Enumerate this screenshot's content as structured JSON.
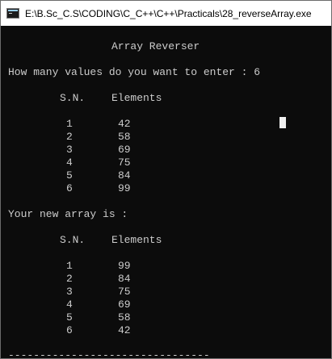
{
  "window": {
    "title": "E:\\B.Sc_C.S\\CODING\\C_C++\\C++\\Practicals\\28_reverseArray.exe"
  },
  "console": {
    "heading": "Array Reverser",
    "prompt": "How many values do you want to enter : 6",
    "col_sn": "S.N.",
    "col_elements": "Elements",
    "input_rows": [
      {
        "sn": "1",
        "value": "42"
      },
      {
        "sn": "2",
        "value": "58"
      },
      {
        "sn": "3",
        "value": "69"
      },
      {
        "sn": "4",
        "value": "75"
      },
      {
        "sn": "5",
        "value": "84"
      },
      {
        "sn": "6",
        "value": "99"
      }
    ],
    "result_label": "Your new array is :",
    "output_rows": [
      {
        "sn": "1",
        "value": "99"
      },
      {
        "sn": "2",
        "value": "84"
      },
      {
        "sn": "3",
        "value": "75"
      },
      {
        "sn": "4",
        "value": "69"
      },
      {
        "sn": "5",
        "value": "58"
      },
      {
        "sn": "6",
        "value": "42"
      }
    ],
    "separator": "--------------------------------"
  },
  "colors": {
    "console_bg": "#0c0c0c",
    "console_text": "#cccccc",
    "titlebar_bg": "#ffffff"
  }
}
